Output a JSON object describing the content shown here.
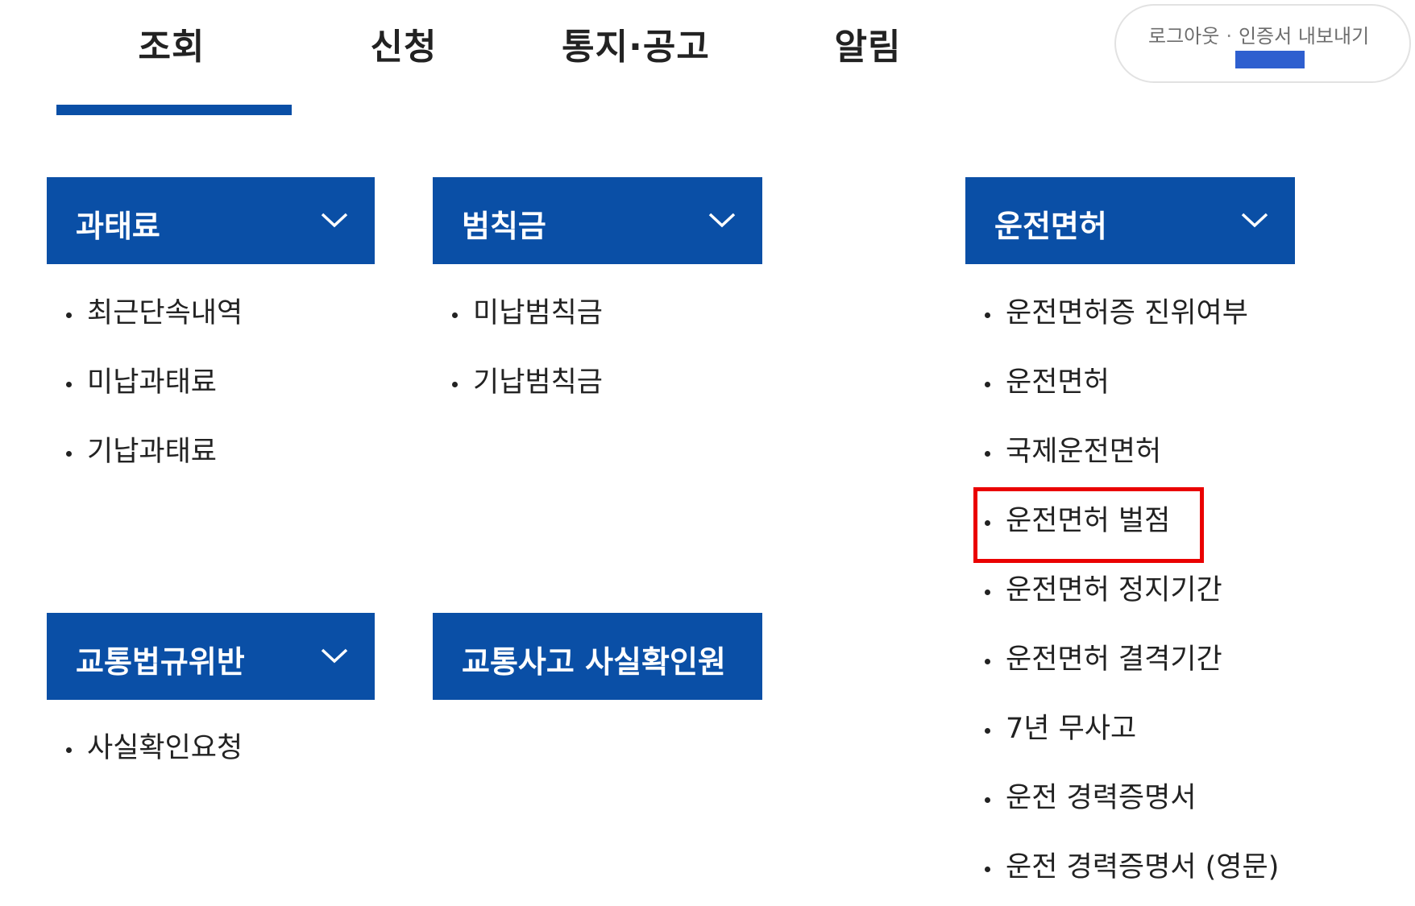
{
  "tabs": [
    {
      "label": "조회",
      "active": true
    },
    {
      "label": "신청",
      "active": false
    },
    {
      "label": "통지·공고",
      "active": false
    },
    {
      "label": "알림",
      "active": false
    }
  ],
  "utility": {
    "logout": "로그아웃",
    "separator": "·",
    "export_cert": "인증서 내보내기"
  },
  "categories": {
    "fine": {
      "title": "과태료",
      "icon": "chevron-down-icon",
      "items": [
        "최근단속내역",
        "미납과태료",
        "기납과태료"
      ]
    },
    "penalty": {
      "title": "범칙금",
      "icon": "chevron-down-icon",
      "items": [
        "미납범칙금",
        "기납범칙금"
      ]
    },
    "license": {
      "title": "운전면허",
      "icon": "chevron-down-icon",
      "items": [
        "운전면허증 진위여부",
        "운전면허",
        "국제운전면허",
        "운전면허 벌점",
        "운전면허 정지기간",
        "운전면허 결격기간",
        "7년 무사고",
        "운전 경력증명서",
        "운전 경력증명서 (영문)"
      ],
      "highlighted_item": "운전면허 벌점"
    },
    "violation": {
      "title": "교통법규위반",
      "icon": "chevron-down-icon",
      "items": [
        "사실확인요청"
      ]
    },
    "accident": {
      "title": "교통사고 사실확인원"
    }
  },
  "colors": {
    "primary_blue": "#0a4fa6",
    "highlight_red": "#ea0000",
    "redaction_blue": "#2e5fcf"
  }
}
